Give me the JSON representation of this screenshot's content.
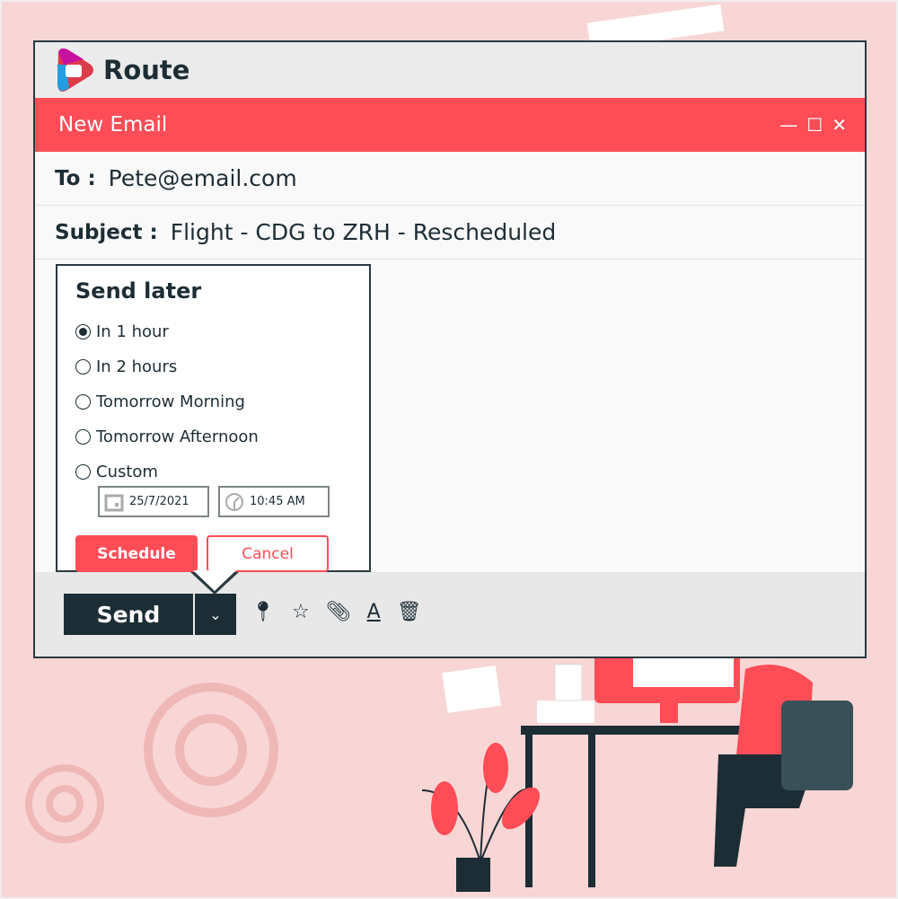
{
  "app": {
    "name": "Route"
  },
  "compose": {
    "title": "New Email",
    "to_label": "To :",
    "to_value": "Pete@email.com",
    "subject_label": "Subject :",
    "subject_value": "Flight - CDG to ZRH - Rescheduled"
  },
  "send_later": {
    "title": "Send later",
    "options": [
      {
        "label": "In 1 hour",
        "selected": true
      },
      {
        "label": "In 2 hours",
        "selected": false
      },
      {
        "label": "Tomorrow Morning",
        "selected": false
      },
      {
        "label": "Tomorrow Afternoon",
        "selected": false
      },
      {
        "label": "Custom",
        "selected": false
      }
    ],
    "date": "25/7/2021",
    "time": "10:45 AM",
    "schedule_label": "Schedule",
    "cancel_label": "Cancel"
  },
  "footer": {
    "send_label": "Send",
    "tools": [
      "location-icon",
      "star-icon",
      "paperclip-icon",
      "text-format-icon",
      "trash-icon"
    ]
  },
  "colors": {
    "accent": "#ff4d57",
    "dark": "#1d2d35",
    "background": "#f8d6d5"
  }
}
